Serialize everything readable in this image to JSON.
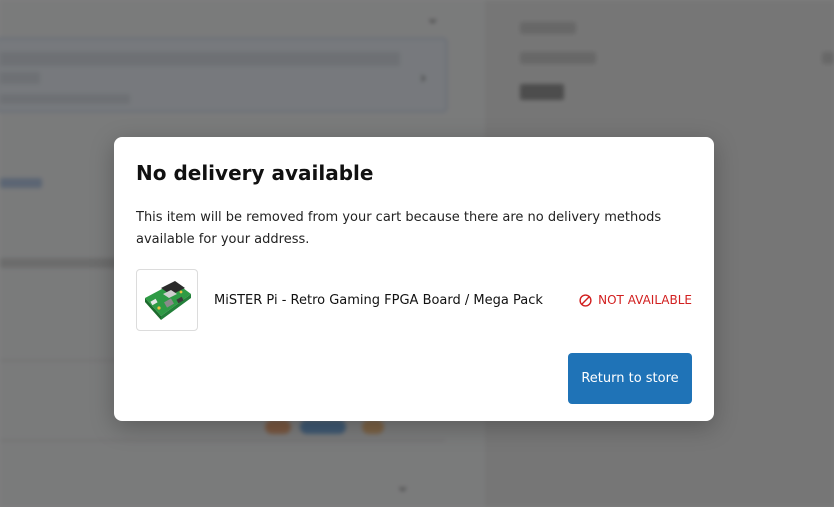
{
  "modal": {
    "title": "No delivery available",
    "message": "This item will be removed from your cart because there are no delivery methods available for your address.",
    "item": {
      "name": "MiSTER Pi - Retro Gaming FPGA Board / Mega Pack",
      "status": "NOT AVAILABLE",
      "status_icon": "prohibited-icon",
      "thumbnail_icon": "fpga-board-image"
    },
    "return_button_label": "Return to store"
  },
  "colors": {
    "accent": "#1f73b7",
    "error": "#d21f1f",
    "overlay": "rgba(0,0,0,0.5)"
  }
}
